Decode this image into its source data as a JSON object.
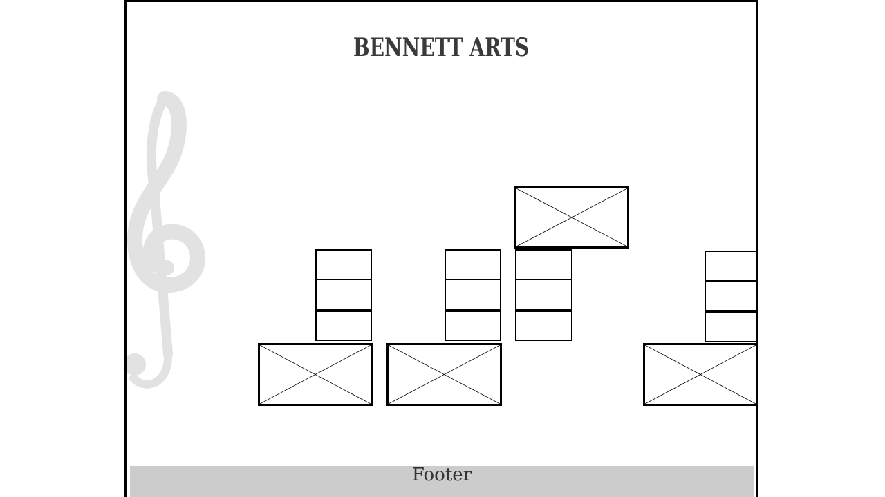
{
  "header": {
    "title": "BENNETT ARTS"
  },
  "background": {
    "icon": "treble-clef-icon",
    "color": "#e0e0e0"
  },
  "footer": {
    "label": "Footer",
    "background": "#cccccc"
  }
}
